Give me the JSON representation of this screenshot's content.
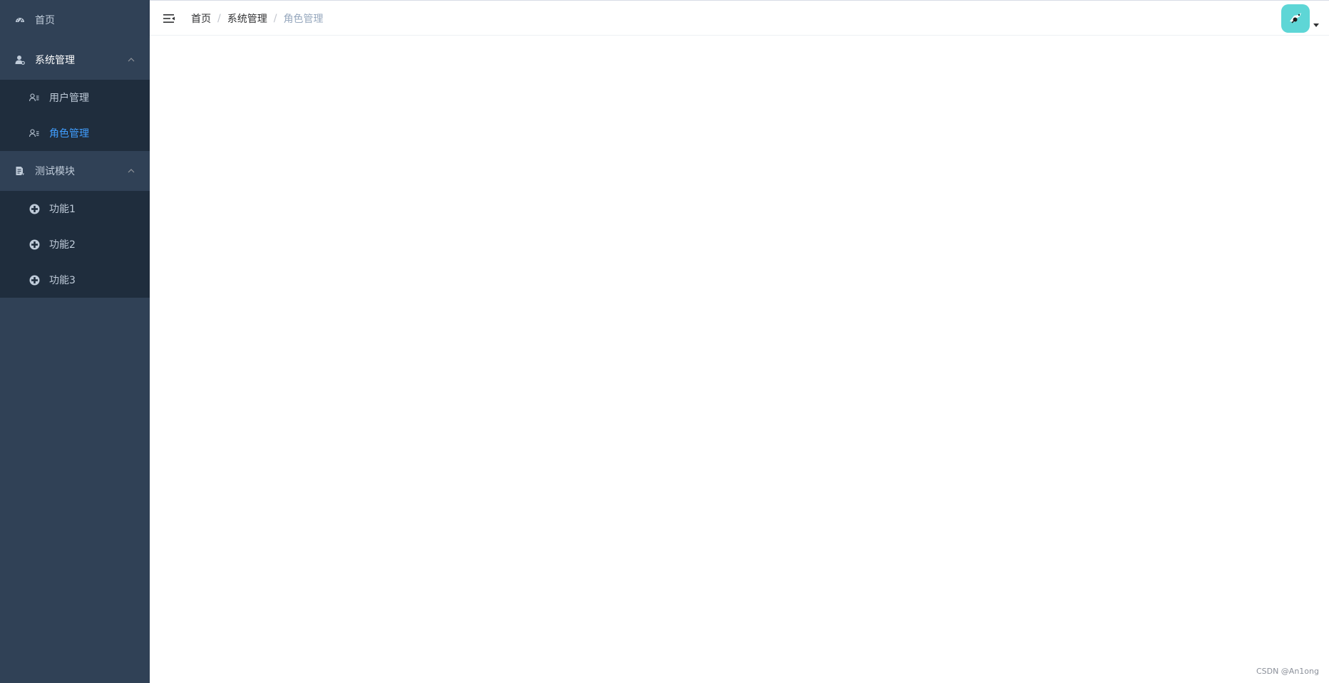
{
  "sidebar": {
    "items": [
      {
        "label": "首页",
        "icon": "dashboard-icon"
      },
      {
        "label": "系统管理",
        "icon": "user-admin-icon",
        "expanded": true,
        "children": [
          {
            "label": "用户管理",
            "icon": "user-list-icon"
          },
          {
            "label": "角色管理",
            "icon": "user-list-icon",
            "active": true
          }
        ]
      },
      {
        "label": "测试模块",
        "icon": "document-icon",
        "expanded": true,
        "children": [
          {
            "label": "功能1",
            "icon": "circle-plus-icon"
          },
          {
            "label": "功能2",
            "icon": "circle-plus-icon"
          },
          {
            "label": "功能3",
            "icon": "circle-plus-icon"
          }
        ]
      }
    ]
  },
  "navbar": {
    "breadcrumb": [
      "首页",
      "系统管理",
      "角色管理"
    ],
    "separator": "/"
  },
  "watermark": "CSDN @An1ong",
  "colors": {
    "sidebar_bg": "#304156",
    "submenu_bg": "#1f2d3d",
    "sidebar_text": "#bfcbd9",
    "active_text": "#409eff",
    "avatar_bg": "#5ed6d6"
  }
}
